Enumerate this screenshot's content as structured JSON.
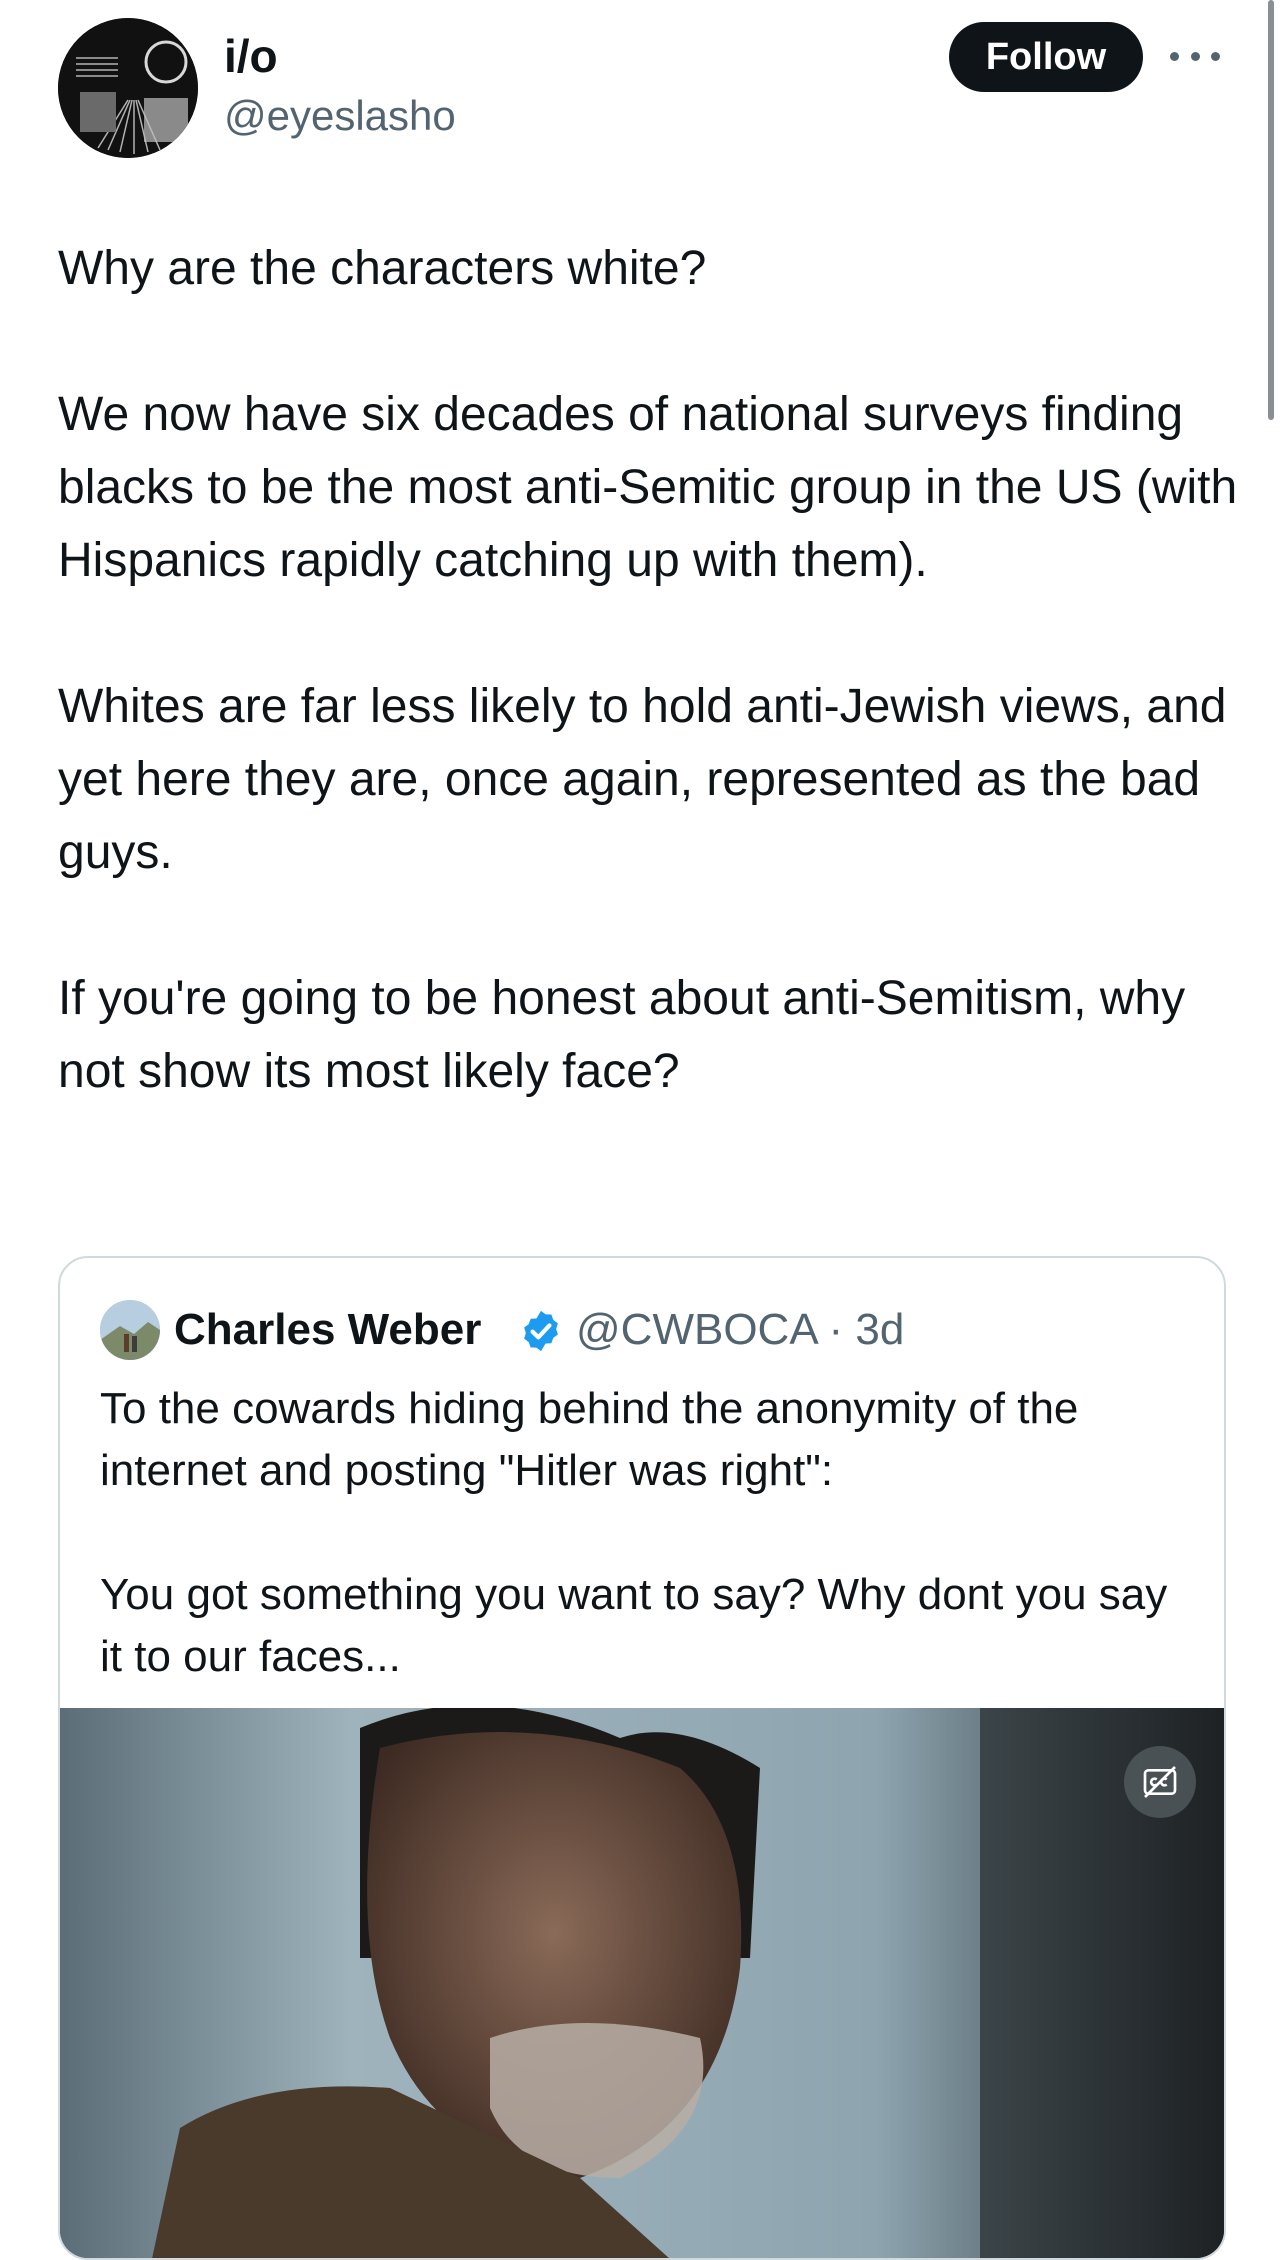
{
  "author": {
    "display_name": "i/o",
    "handle": "@eyeslasho",
    "follow_label": "Follow",
    "more_icon": "ellipsis-icon"
  },
  "tweet": {
    "paragraphs": [
      "Why are the characters white?",
      "We now have six decades of national surveys finding blacks to be the most anti-Semitic group in the US (with Hispanics rapidly catching up with them).",
      "Whites are far less likely to hold anti-Jewish views, and yet here they are, once again, represented as the bad guys.",
      "If you're going to be honest about anti-Semitism, why not show its most likely face?"
    ]
  },
  "quote": {
    "display_name": "Charles Weber",
    "verified_icon": "verified-badge-icon",
    "handle": "@CWBOCA",
    "time": "· 3d",
    "paragraphs": [
      "To the cowards hiding behind the anonymity of the internet and posting \"Hitler was right\":",
      "You got something you want to say? Why dont you say it to our faces..."
    ],
    "media_icon": "closed-captions-icon"
  },
  "colors": {
    "text": "#0f1419",
    "secondary": "#536471",
    "border": "#cfd9de",
    "verified": "#1d9bf0"
  }
}
